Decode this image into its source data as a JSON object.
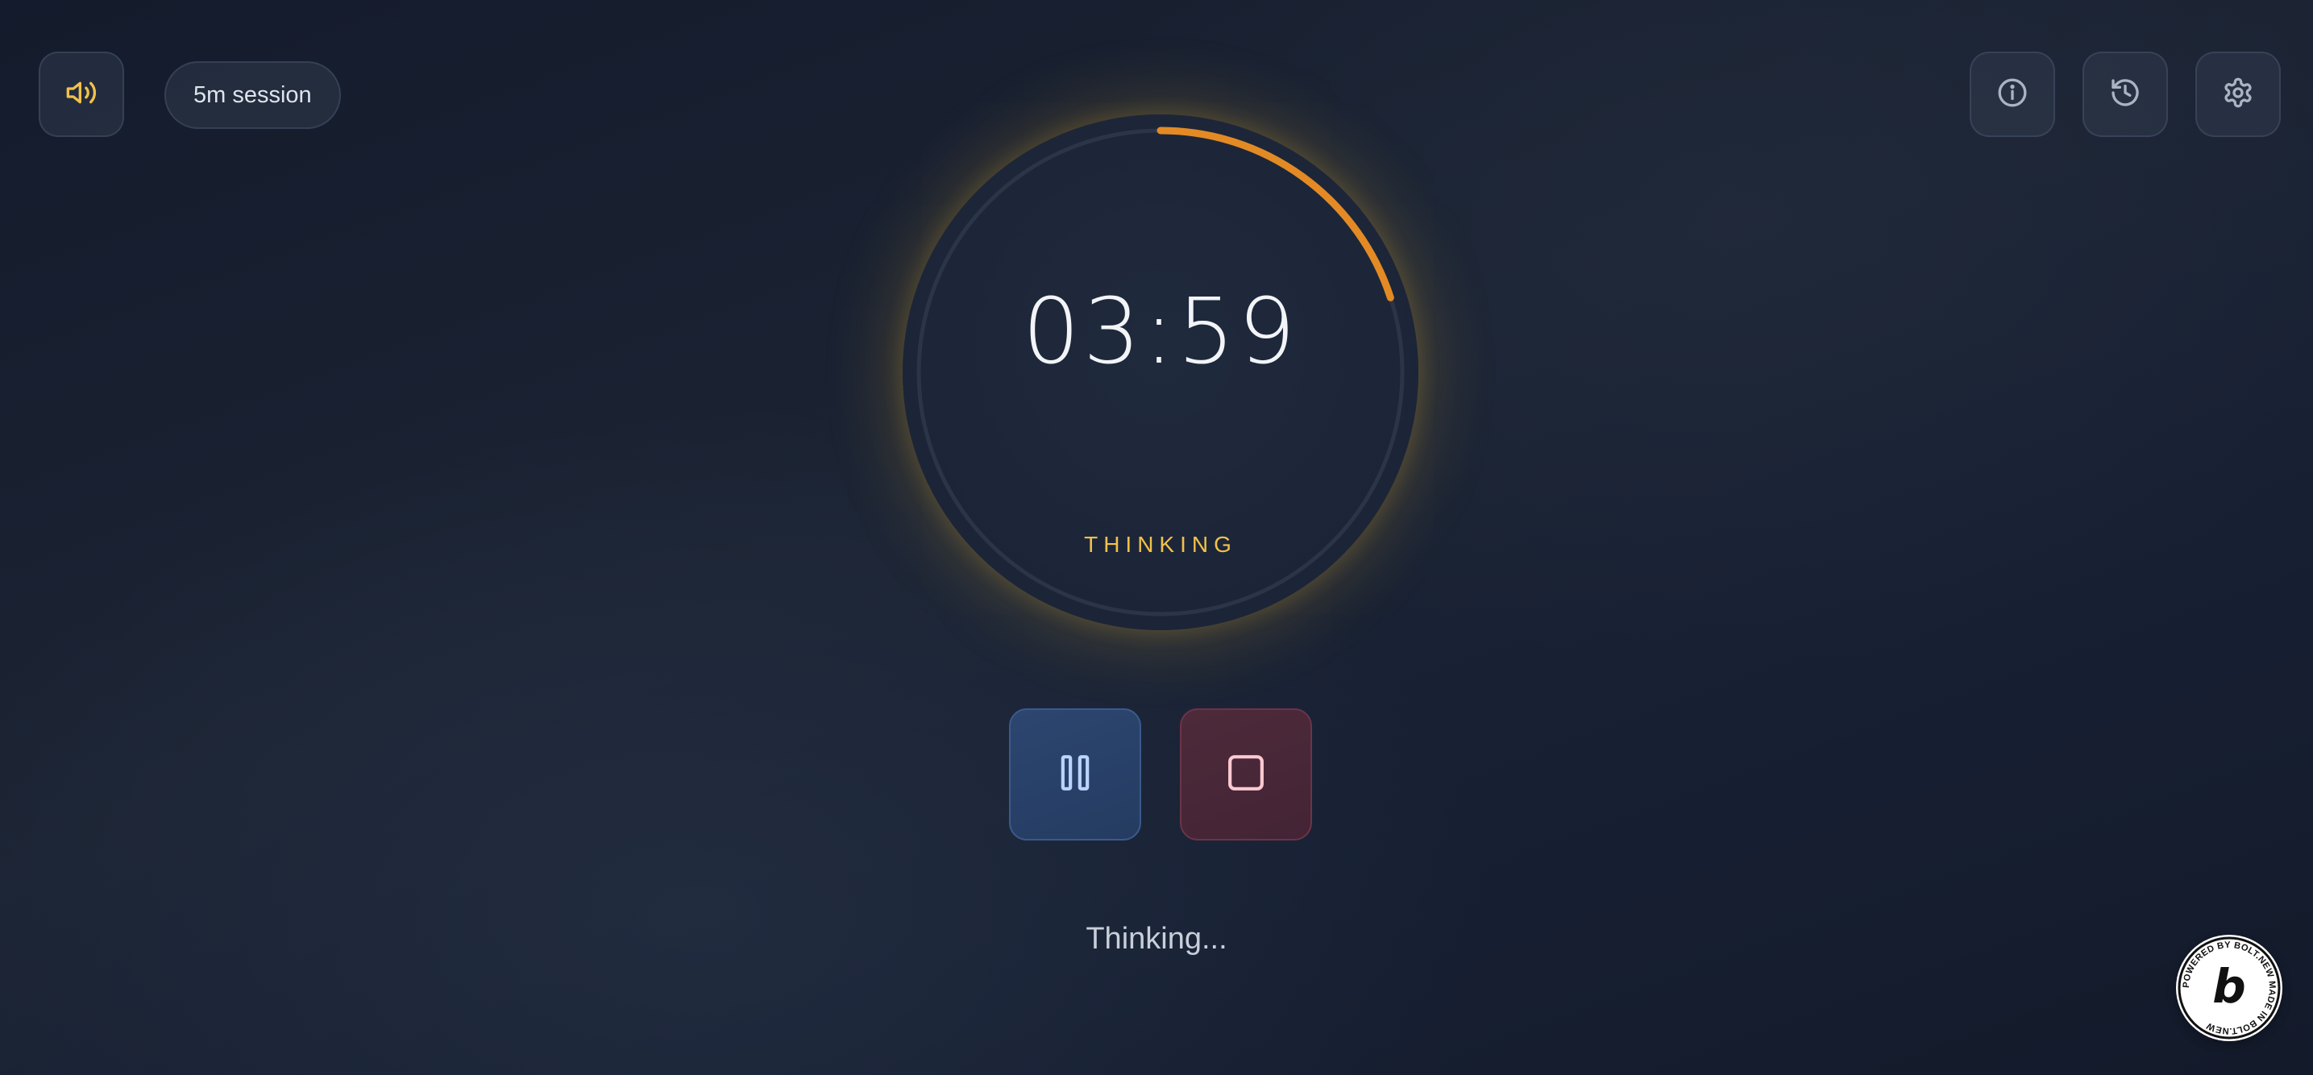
{
  "header": {
    "session_label": "5m session"
  },
  "timer": {
    "time": "03:59",
    "state": "THINKING",
    "progress_fraction": 0.2,
    "ring_color": "#e38a25",
    "accent_color": "#f2c14a"
  },
  "controls": {
    "pause_icon": "pause-icon",
    "stop_icon": "stop-icon"
  },
  "status": {
    "text": "Thinking..."
  },
  "badge": {
    "text": "POWERED BY BOLT.NEW MADE IN BOLT.NEW",
    "letter": "b"
  },
  "icons": [
    "volume-icon",
    "info-icon",
    "history-icon",
    "settings-icon"
  ]
}
